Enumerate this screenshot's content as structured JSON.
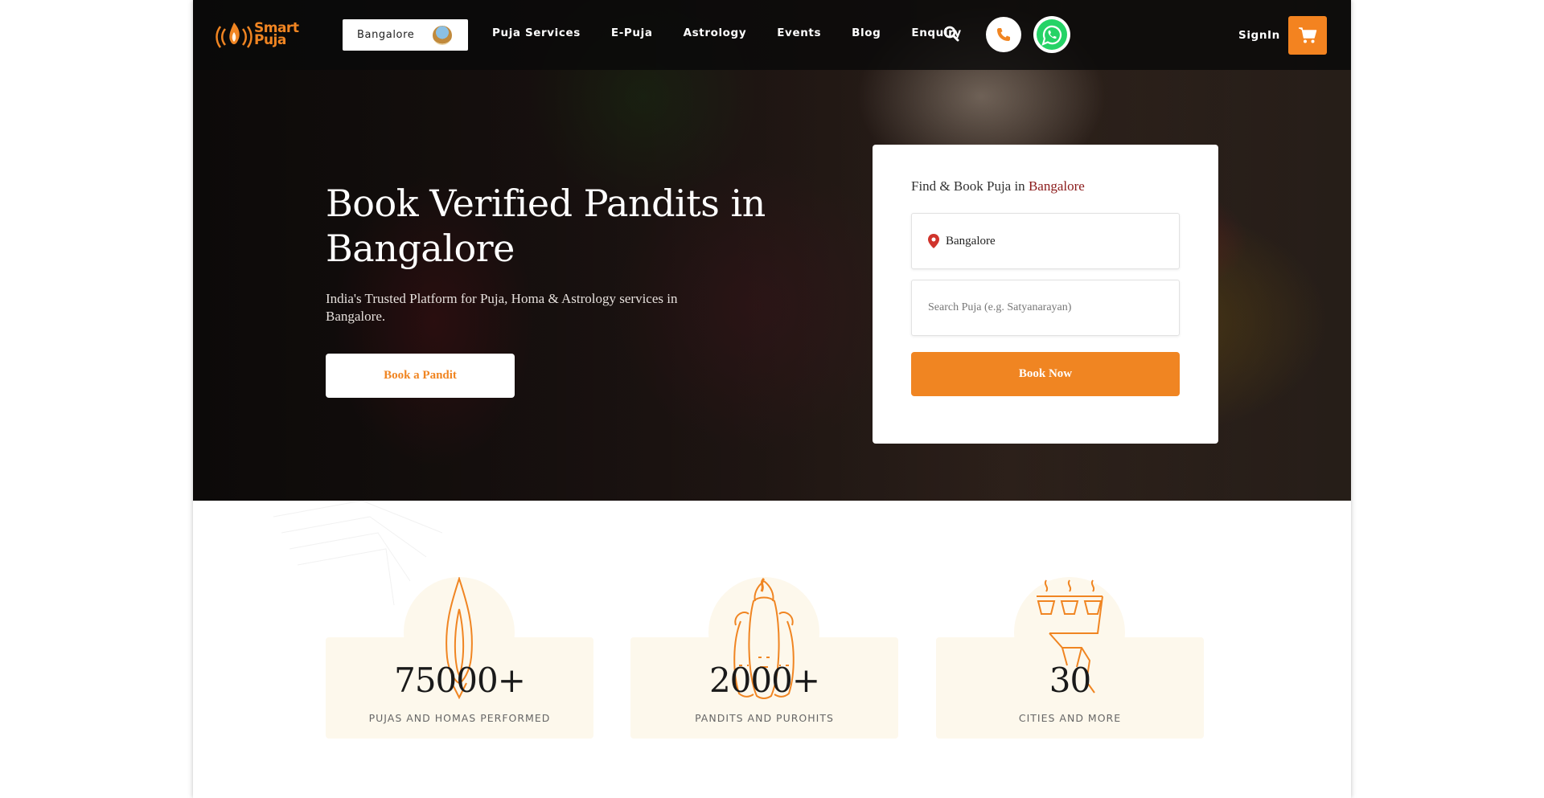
{
  "brand": {
    "name_line1": "Smart",
    "name_line2": "Puja",
    "accent_color": "#f08522"
  },
  "nav": {
    "city": "Bangalore",
    "links": [
      "Puja Services",
      "E-Puja",
      "Astrology",
      "Events",
      "Blog",
      "Enquiry"
    ],
    "signin": "SignIn"
  },
  "hero": {
    "title": "Book Verified Pandits in Bangalore",
    "subtitle": "India's Trusted Platform for Puja, Homa & Astrology services in Bangalore.",
    "cta": "Book a Pandit"
  },
  "booking": {
    "title_prefix": "Find & Book Puja in",
    "title_city": "Bangalore",
    "location_value": "Bangalore",
    "search_placeholder": "Search Puja (e.g. Satyanarayan)",
    "submit": "Book Now"
  },
  "stats": [
    {
      "value": "75000+",
      "label": "PUJAS AND HOMAS PERFORMED",
      "icon": "flame-icon"
    },
    {
      "value": "2000+",
      "label": "PANDITS AND PUROHITS",
      "icon": "pandit-icon"
    },
    {
      "value": "30",
      "label": "CITIES AND MORE",
      "icon": "diya-icon"
    }
  ]
}
